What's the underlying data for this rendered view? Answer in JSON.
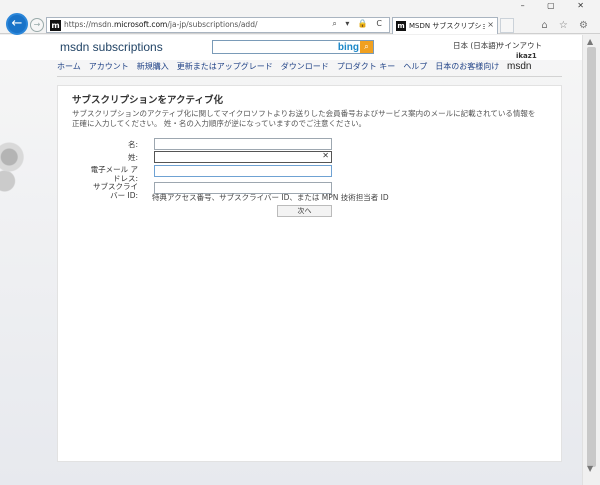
{
  "browser": {
    "url_prefix": "https://msdn.",
    "url_host": "microsoft.com",
    "url_path": "/ja-jp/subscriptions/add/",
    "address_tools": "⌕ ▾ 🔒 C",
    "tab_title": "MSDN サブスクリプションをアク...",
    "tab_close": "×",
    "site_icon": "m",
    "window_controls": "– ▢ ✕",
    "tools_icons": "⌂ ☆ ⚙"
  },
  "header": {
    "brand": "msdn subscriptions",
    "search_placeholder": "",
    "bing": "bing",
    "language": "日本 (日本語)",
    "signout": "サインアウト",
    "user": "ikaz1",
    "msdn_logo": "msdn"
  },
  "nav": {
    "items": [
      "ホーム",
      "アカウント",
      "新規購入",
      "更新またはアップグレード",
      "ダウンロード",
      "プロダクト キー",
      "ヘルプ",
      "日本のお客様向け"
    ]
  },
  "form": {
    "title": "サブスクリプションをアクティブ化",
    "description": "サブスクリプションのアクティブ化に関してマイクロソフトよりお送りした会員番号およびサービス案内のメールに記載されている情報を正確に入力してください。 姓・名の入力順序が逆になっていますのでご注意ください。",
    "first_name_label": "名:",
    "first_name_value": "",
    "last_name_label": "姓:",
    "last_name_value": "",
    "email_label_line1": "電子メール ア",
    "email_label_line2": "ドレス:",
    "email_value": "",
    "subscriber_label_line1": "サブスクライ",
    "subscriber_label_line2": "バー ID:",
    "subscriber_value": "",
    "hint": "特典アクセス番号、サブスクライバー ID、または MPN 技術担当者 ID",
    "next_button": "次へ"
  }
}
